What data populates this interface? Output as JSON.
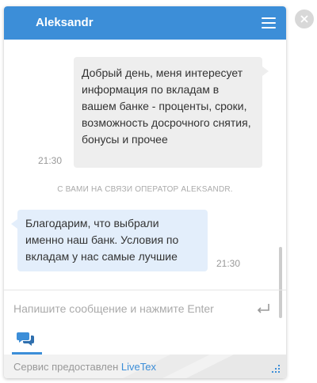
{
  "header": {
    "title": "Aleksandr"
  },
  "messages": {
    "outgoing": {
      "text": "Добрый день, меня интересует информация по вкладам в вашем банке - проценты, сроки, возможность досрочного снятия, бонусы и прочее",
      "time": "21:30"
    },
    "system_notice": "С ВАМИ НА СВЯЗИ ОПЕРАТОР ALEKSANDR.",
    "incoming": {
      "text": "Благодарим, что выбрали именно наш банк. Условия по вкладам у нас самые лучшие",
      "time": "21:30"
    }
  },
  "input": {
    "placeholder": "Напишите сообщение и нажмите Enter",
    "value": ""
  },
  "footer": {
    "prefix": "Сервис предоставлен ",
    "brand": "LiveTex"
  },
  "colors": {
    "accent": "#3c8ed8",
    "outgoing_bubble": "#eeeeee",
    "incoming_bubble": "#e3eefb"
  },
  "icons": {
    "menu": "menu-icon",
    "close": "close-icon",
    "send": "enter-icon",
    "chat_tab": "chat-bubbles-icon",
    "resize": "resize-grip-icon"
  }
}
